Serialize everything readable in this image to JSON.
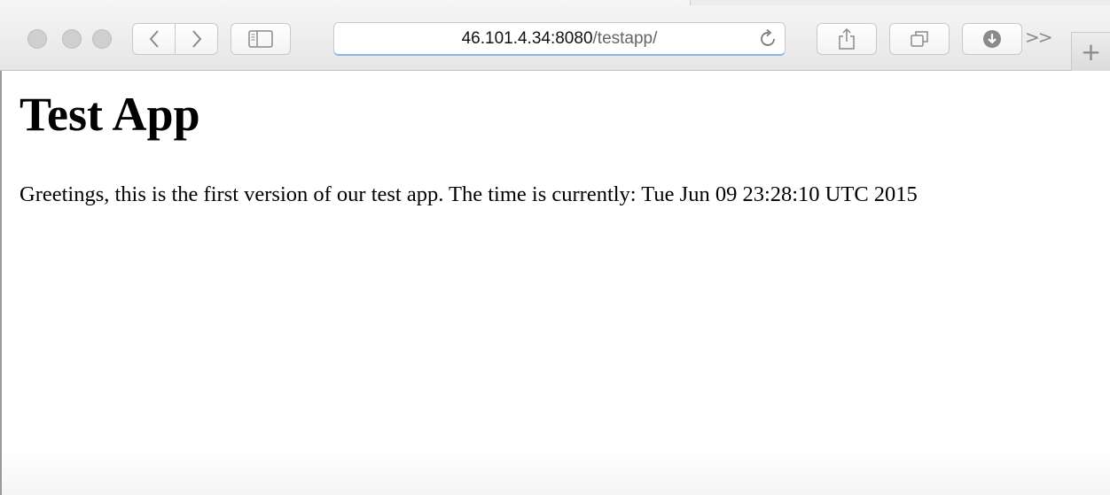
{
  "browser": {
    "address_bar": {
      "host": "46.101.4.34:8080",
      "path": "/testapp/"
    },
    "overflow_label": ">>",
    "new_tab_label": "+",
    "icons": [
      "back-icon",
      "forward-icon",
      "sidebar-icon",
      "reload-icon",
      "share-icon",
      "tabs-overview-icon",
      "download-icon"
    ]
  },
  "page": {
    "title": "Test App",
    "message": "Greetings, this is the first version of our test app. The time is currently: Tue Jun 09 23:28:10 UTC 2015"
  }
}
